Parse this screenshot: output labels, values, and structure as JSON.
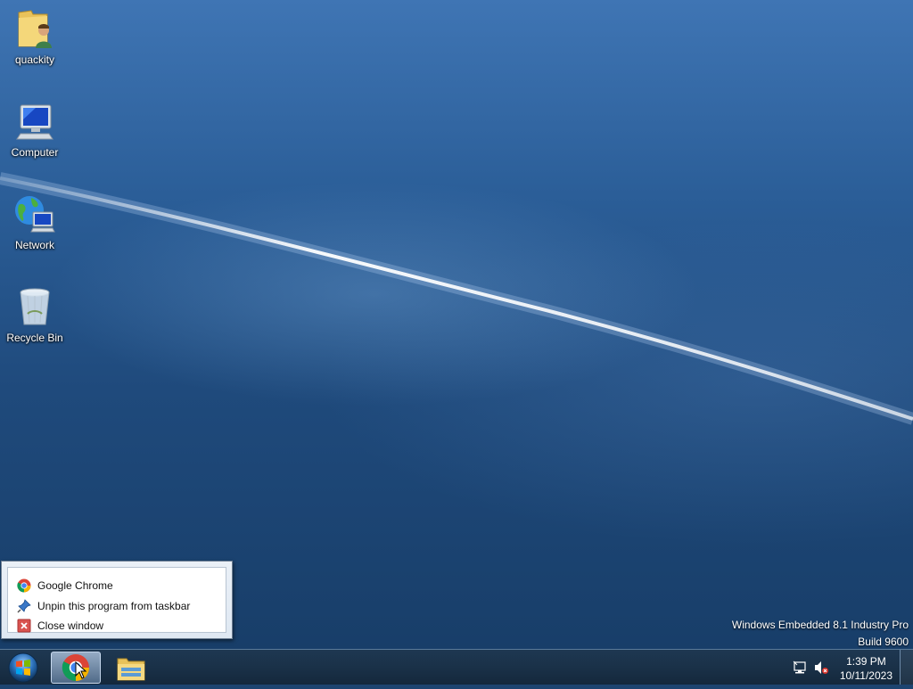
{
  "desktop": {
    "icons": [
      {
        "label": "quackity",
        "icon": "user-folder-icon"
      },
      {
        "label": "Computer",
        "icon": "computer-icon"
      },
      {
        "label": "Network",
        "icon": "network-icon"
      },
      {
        "label": "Recycle Bin",
        "icon": "recycle-bin-icon"
      }
    ],
    "watermark": {
      "line1": "Windows Embedded 8.1 Industry Pro",
      "line2": "Build 9600"
    }
  },
  "jump_list": {
    "items": [
      {
        "label": "Google Chrome",
        "icon": "chrome-icon"
      },
      {
        "label": "Unpin this program from taskbar",
        "icon": "pin-icon"
      },
      {
        "label": "Close window",
        "icon": "close-icon"
      }
    ]
  },
  "taskbar": {
    "start_icon": "windows-start-icon",
    "pinned": [
      {
        "name": "Google Chrome",
        "icon": "chrome-icon",
        "active": true
      },
      {
        "name": "File Explorer",
        "icon": "file-explorer-icon",
        "active": false
      }
    ],
    "tray": {
      "icons": [
        "network-status-icon",
        "volume-muted-icon"
      ],
      "time": "1:39 PM",
      "date": "10/11/2023"
    }
  }
}
